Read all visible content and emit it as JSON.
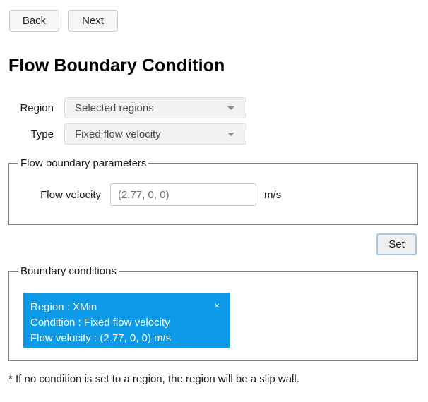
{
  "nav": {
    "back_label": "Back",
    "next_label": "Next"
  },
  "page": {
    "title": "Flow Boundary Condition"
  },
  "form": {
    "region": {
      "label": "Region",
      "selected": "Selected regions"
    },
    "type": {
      "label": "Type",
      "selected": "Fixed flow velocity"
    }
  },
  "parameters_group": {
    "legend": "Flow boundary parameters",
    "flow_velocity": {
      "label": "Flow velocity",
      "value": "(2.77, 0, 0)",
      "placeholder": "(2.77, 0, 0)",
      "unit": "m/s"
    }
  },
  "actions": {
    "set_label": "Set"
  },
  "conditions_group": {
    "legend": "Boundary conditions",
    "card": {
      "region_line": "Region : XMin",
      "condition_line": "Condition : Fixed flow velocity",
      "velocity_line": "Flow velocity : (2.77, 0, 0) m/s",
      "close_label": "×",
      "background_color": "#0c9ae9"
    }
  },
  "footer": {
    "note": "* If no condition is set to a region, the region will be a slip wall."
  }
}
